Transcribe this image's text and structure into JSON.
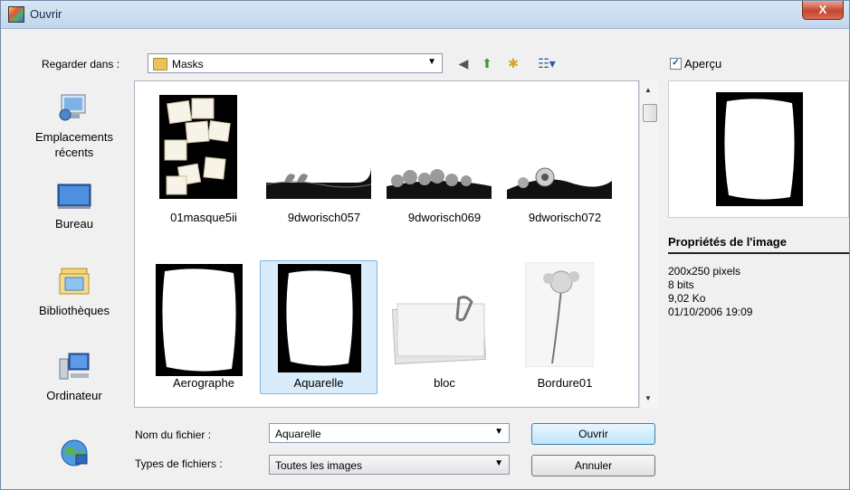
{
  "window": {
    "title": "Ouvrir",
    "close_glyph": "X"
  },
  "look_in": {
    "label": "Regarder dans :",
    "value": "Masks"
  },
  "toolbar": {
    "back": "◀",
    "up": "⬆",
    "new_folder": "✱",
    "views": "☷▾"
  },
  "preview": {
    "label": "Aperçu",
    "checked": true
  },
  "places": [
    {
      "label": "Emplacements récents",
      "icon": "recent-places-icon"
    },
    {
      "label": "Bureau",
      "icon": "desktop-icon"
    },
    {
      "label": "Bibliothèques",
      "icon": "libraries-icon"
    },
    {
      "label": "Ordinateur",
      "icon": "computer-icon"
    },
    {
      "label": "",
      "icon": "network-icon"
    }
  ],
  "files": [
    {
      "name": "01masque5ii",
      "kind": "collage"
    },
    {
      "name": "9dworisch057",
      "kind": "swan"
    },
    {
      "name": "9dworisch069",
      "kind": "flowers"
    },
    {
      "name": "9dworisch072",
      "kind": "daisy"
    },
    {
      "name": "Aerographe",
      "kind": "frame"
    },
    {
      "name": "Aquarelle",
      "kind": "frame",
      "selected": true
    },
    {
      "name": "bloc",
      "kind": "notepad"
    },
    {
      "name": "Bordure01",
      "kind": "lily"
    }
  ],
  "file_name": {
    "label": "Nom du fichier :",
    "value": "Aquarelle"
  },
  "file_type": {
    "label": "Types de fichiers :",
    "value": "Toutes les images"
  },
  "buttons": {
    "open": "Ouvrir",
    "cancel": "Annuler"
  },
  "properties": {
    "title": "Propriétés de l'image",
    "dimensions": "200x250 pixels",
    "depth": "8 bits",
    "size": "9,02 Ko",
    "date": "01/10/2006 19:09"
  },
  "colors": {
    "selection": "#d8ecfb",
    "selection_border": "#7fb5e3",
    "title_bar": "#c2d6ec"
  }
}
